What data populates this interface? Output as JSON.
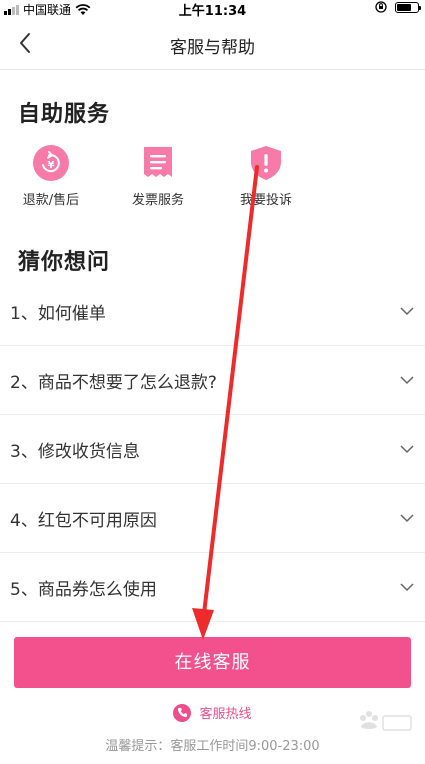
{
  "status_bar": {
    "carrier": "中国联通",
    "time": "上午11:34"
  },
  "nav": {
    "title": "客服与帮助",
    "back_icon": "chevron-left-icon"
  },
  "self_service": {
    "title": "自助服务",
    "items": [
      {
        "label": "退款/售后",
        "icon": "refund-icon"
      },
      {
        "label": "发票服务",
        "icon": "invoice-icon"
      },
      {
        "label": "我要投诉",
        "icon": "complaint-shield-icon"
      }
    ]
  },
  "faq": {
    "title": "猜你想问",
    "questions": [
      {
        "text": "1、如何催单"
      },
      {
        "text": "2、商品不想要了怎么退款?"
      },
      {
        "text": "3、修改收货信息"
      },
      {
        "text": "4、红包不可用原因"
      },
      {
        "text": "5、商品券怎么使用"
      }
    ]
  },
  "online_service_button": "在线客服",
  "hotline_label": "客服热线",
  "tip": "温馨提示：客服工作时间9:00-23:00",
  "colors": {
    "accent": "#f2518e",
    "icon_pink": "#f77aa8",
    "annotation_arrow": "#ee2b2b"
  }
}
